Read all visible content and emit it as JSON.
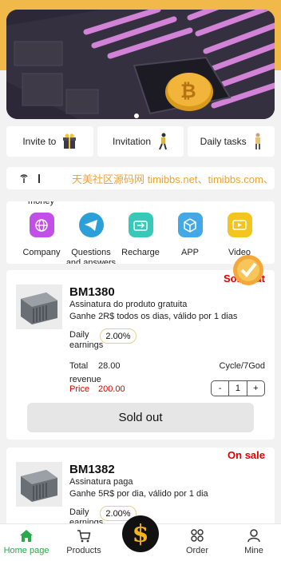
{
  "quick_tabs": [
    {
      "label": "Invite to",
      "icon": "gift-icon"
    },
    {
      "label": "Invitation",
      "icon": "person-walking-icon"
    },
    {
      "label": "Daily tasks",
      "icon": "person-standing-icon"
    }
  ],
  "notice": {
    "icon": "broadcast-icon",
    "text": "天美社区源码网 timibbs.net、timibbs.com、"
  },
  "icon_row": {
    "overflow_label": "money",
    "items": [
      {
        "label": "Company",
        "icon": "globe-icon",
        "color": "#c250e8"
      },
      {
        "label": "Questions and answers",
        "icon": "telegram-icon",
        "color": "#2a9fd8"
      },
      {
        "label": "Recharge",
        "icon": "recharge-icon",
        "color": "#36c9b8"
      },
      {
        "label": "APP",
        "icon": "cube-icon",
        "color": "#43a8e8"
      },
      {
        "label": "Video",
        "icon": "video-icon",
        "color": "#f3c51e"
      }
    ]
  },
  "products": [
    {
      "name": "BM1380",
      "status": "Sold out",
      "desc1": "Assinatura do produto gratuita",
      "desc2": "Ganhe 2R$ todos os dias, válido por 1 dias",
      "daily_label": "Daily earnings",
      "daily_value": "2.00%",
      "total_label": "Total revenue",
      "total_value": "28.00",
      "cycle": "Cycle/7God",
      "price_label": "Price",
      "price_value": "200.00",
      "qty_minus": "-",
      "qty": "1",
      "qty_plus": "+",
      "button": "Sold out"
    },
    {
      "name": "BM1382",
      "status": "On sale",
      "desc1": "Assinatura paga",
      "desc2": "Ganhe 5R$ por dia, válido por 1 dia",
      "daily_label": "Daily earnings",
      "daily_value": "2.00%"
    }
  ],
  "tabbar": {
    "home": "Home page",
    "products": "Products",
    "center_symbol": "$",
    "order": "Order",
    "mine": "Mine"
  },
  "colors": {
    "accent": "#2aa84a",
    "sale_red": "#e00000",
    "top_band": "#f0b94a"
  }
}
